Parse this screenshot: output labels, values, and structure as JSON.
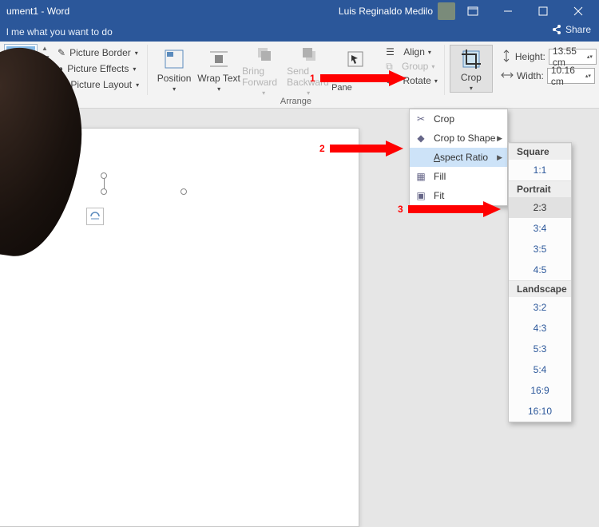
{
  "title": "ument1 - Word",
  "user_name": "Luis Reginaldo Medilo",
  "tellme": "l me what you want to do",
  "share_label": "Share",
  "pic": {
    "border": "Picture Border",
    "effects": "Picture Effects",
    "layout": "Picture Layout"
  },
  "arrange": {
    "position": "Position",
    "wrap": "Wrap Text",
    "bring": "Bring Forward",
    "send": "Send Backward",
    "selpane": "Selection Pane",
    "align": "Align",
    "group": "Group",
    "rotate": "Rotate",
    "group_label": "Arrange"
  },
  "crop_label": "Crop",
  "size": {
    "height_label": "Height:",
    "width_label": "Width:",
    "height_val": "13.55 cm",
    "width_val": "10.16 cm"
  },
  "cropmenu": {
    "crop": "Crop",
    "shape": "Crop to Shape",
    "aspect": "Aspect Ratio",
    "fill": "Fill",
    "fit": "Fit"
  },
  "ratios": {
    "square_h": "Square",
    "sq": "1:1",
    "portrait_h": "Portrait",
    "p1": "2:3",
    "p2": "3:4",
    "p3": "3:5",
    "p4": "4:5",
    "landscape_h": "Landscape",
    "l1": "3:2",
    "l2": "4:3",
    "l3": "5:3",
    "l4": "5:4",
    "l5": "16:9",
    "l6": "16:10"
  },
  "annotations": {
    "a1": "1",
    "a2": "2",
    "a3": "3"
  }
}
